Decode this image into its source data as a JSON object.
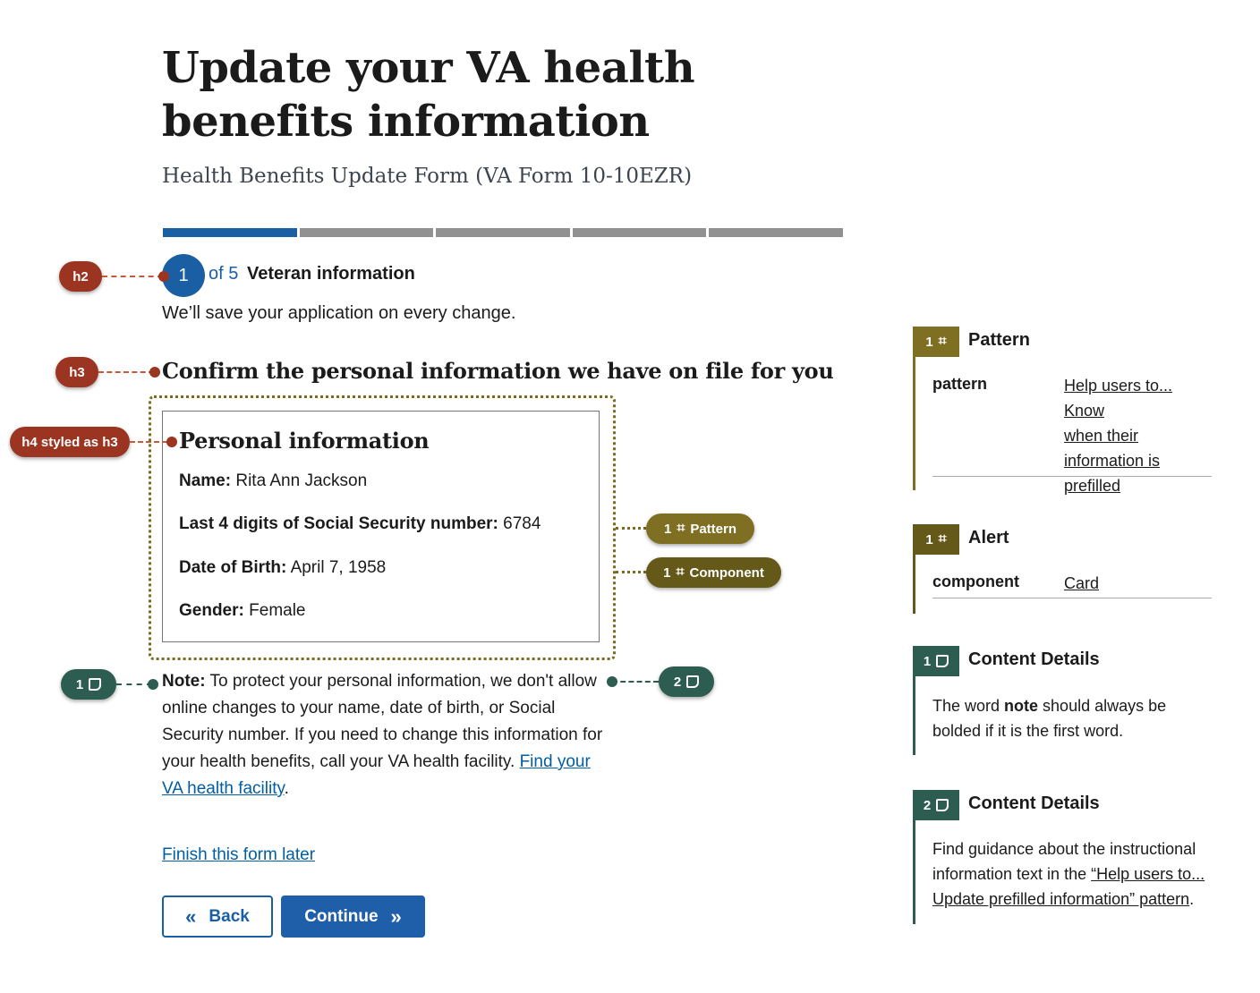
{
  "header": {
    "title": "Update your VA health benefits information",
    "subtitle": "Health Benefits Update Form (VA Form 10-10EZR)"
  },
  "progress": {
    "total_segments": 5,
    "current": 1
  },
  "step": {
    "number": "1",
    "of_label": "of 5",
    "title": "Veteran information",
    "save_note": "We’ll save your application on every change."
  },
  "section": {
    "heading": "Confirm the personal information we have on file for you"
  },
  "card": {
    "title": "Personal information",
    "rows": [
      {
        "label": "Name:",
        "value": "Rita Ann Jackson"
      },
      {
        "label": "Last 4 digits of Social Security number:",
        "value": "6784"
      },
      {
        "label": "Date of Birth:",
        "value": "April 7, 1958"
      },
      {
        "label": "Gender:",
        "value": "Female"
      }
    ]
  },
  "note": {
    "label": "Note:",
    "text": "To protect your personal information, we don't allow online changes to your name, date of birth, or Social Security number. If you need to change this information for your health benefits, call your VA health facility.",
    "link_text": "Find your VA health facility",
    "end": "."
  },
  "actions": {
    "finish_later": "Finish this form later",
    "back": "Back",
    "continue": "Continue"
  },
  "annotations": {
    "h2": "h2",
    "h3": "h3",
    "h4": "h4 styled as h3",
    "pattern_pill": {
      "num": "1",
      "label": "Pattern"
    },
    "component_pill": {
      "num": "1",
      "label": "Component"
    },
    "note1": "1",
    "note2": "2"
  },
  "panels": {
    "pattern": {
      "num": "1",
      "title": "Pattern",
      "key": "pattern",
      "value_lines": [
        "Help users to... Know",
        "when their",
        "information is",
        "prefilled"
      ]
    },
    "alert": {
      "num": "1",
      "title": "Alert",
      "key": "component",
      "value": "Card"
    },
    "content1": {
      "num": "1",
      "title": "Content Details",
      "text_pre": "The word ",
      "text_bold": "note",
      "text_post": " should always be bolded if it is the first word."
    },
    "content2": {
      "num": "2",
      "title": "Content Details",
      "text_pre": "Find guidance about the instructional information text in the ",
      "link": "“Help users to... Update prefilled information” pattern",
      "text_post": "."
    }
  },
  "colors": {
    "primary": "#1a5fa4",
    "annotation_heading": "#9b3421",
    "annotation_pattern": "#7f6f22",
    "annotation_component": "#65591a",
    "annotation_content": "#2c5d50"
  }
}
